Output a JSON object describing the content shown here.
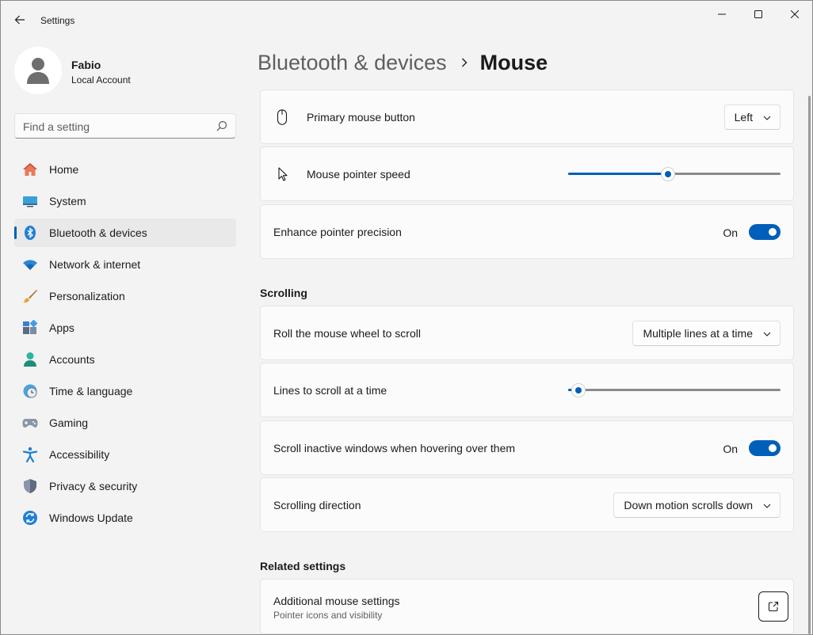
{
  "window": {
    "title": "Settings"
  },
  "profile": {
    "name": "Fabio",
    "account_type": "Local Account"
  },
  "search": {
    "placeholder": "Find a setting"
  },
  "nav": {
    "items": [
      {
        "label": "Home",
        "icon": "home-icon"
      },
      {
        "label": "System",
        "icon": "system-icon"
      },
      {
        "label": "Bluetooth & devices",
        "icon": "bluetooth-icon",
        "active": true
      },
      {
        "label": "Network & internet",
        "icon": "wifi-icon"
      },
      {
        "label": "Personalization",
        "icon": "brush-icon"
      },
      {
        "label": "Apps",
        "icon": "apps-icon"
      },
      {
        "label": "Accounts",
        "icon": "accounts-icon"
      },
      {
        "label": "Time & language",
        "icon": "globe-clock-icon"
      },
      {
        "label": "Gaming",
        "icon": "gamepad-icon"
      },
      {
        "label": "Accessibility",
        "icon": "accessibility-icon"
      },
      {
        "label": "Privacy & security",
        "icon": "shield-icon"
      },
      {
        "label": "Windows Update",
        "icon": "update-icon"
      }
    ]
  },
  "breadcrumb": {
    "parent": "Bluetooth & devices",
    "current": "Mouse"
  },
  "settings": {
    "primary_button": {
      "label": "Primary mouse button",
      "value": "Left"
    },
    "pointer_speed": {
      "label": "Mouse pointer speed",
      "value_fraction": 0.47
    },
    "precision": {
      "label": "Enhance pointer precision",
      "state": "On"
    }
  },
  "scrolling": {
    "title": "Scrolling",
    "wheel": {
      "label": "Roll the mouse wheel to scroll",
      "value": "Multiple lines at a time"
    },
    "lines": {
      "label": "Lines to scroll at a time",
      "value_fraction": 0.05
    },
    "inactive": {
      "label": "Scroll inactive windows when hovering over them",
      "state": "On"
    },
    "direction": {
      "label": "Scrolling direction",
      "value": "Down motion scrolls down"
    }
  },
  "related": {
    "title": "Related settings",
    "additional": {
      "label": "Additional mouse settings",
      "sub": "Pointer icons and visibility"
    }
  },
  "colors": {
    "accent": "#005fb8",
    "background": "#f3f3f3",
    "card": "#fbfbfb"
  }
}
